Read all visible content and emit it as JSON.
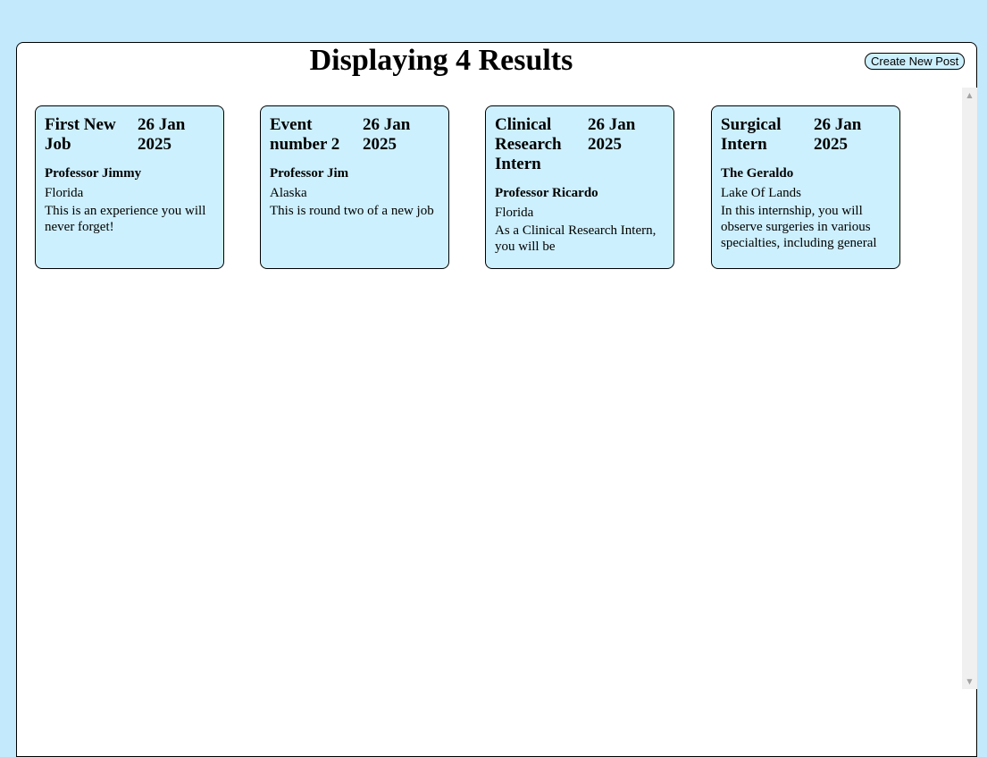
{
  "header": {
    "title": "Displaying 4 Results",
    "create_button_label": "Create New Post"
  },
  "posts": [
    {
      "title": "First New Job",
      "date": "26 Jan 2025",
      "host": "Professor Jimmy",
      "location": "Florida",
      "description": "This is an experience you will never forget!"
    },
    {
      "title": "Event number 2",
      "date": "26 Jan 2025",
      "host": "Professor Jim",
      "location": "Alaska",
      "description": "This is round two of a new job"
    },
    {
      "title": "Clinical Research Intern",
      "date": "26 Jan 2025",
      "host": "Professor Ricardo",
      "location": "Florida",
      "description": "As a Clinical Research Intern, you will be"
    },
    {
      "title": "Surgical Intern",
      "date": "26 Jan 2025",
      "host": "The Geraldo",
      "location": "Lake Of Lands",
      "description": "In this internship, you will observe surgeries in various specialties, including general surgery, orthopedics, and"
    }
  ],
  "icons": {
    "scroll_up": "scroll-up-arrow-icon",
    "scroll_down": "scroll-down-arrow-icon"
  },
  "colors": {
    "page_background": "#c3e9fd",
    "card_background": "#cdf0fe"
  }
}
